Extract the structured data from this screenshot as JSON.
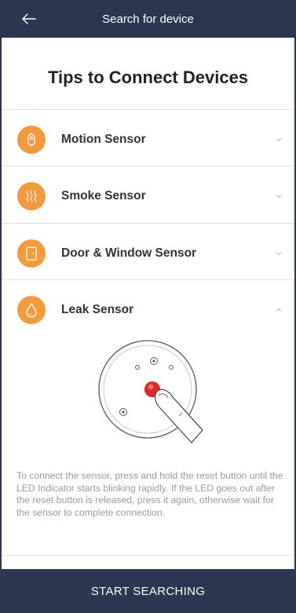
{
  "header": {
    "title": "Search for device",
    "back_icon": "arrow-left-icon"
  },
  "page": {
    "title": "Tips to Connect Devices"
  },
  "devices": [
    {
      "label": "Motion Sensor",
      "icon": "motion-sensor-icon",
      "expanded": false
    },
    {
      "label": "Smoke Sensor",
      "icon": "smoke-sensor-icon",
      "expanded": false
    },
    {
      "label": "Door & Window Sensor",
      "icon": "door-window-sensor-icon",
      "expanded": false
    },
    {
      "label": "Leak Sensor",
      "icon": "leak-sensor-icon",
      "expanded": true
    }
  ],
  "leak_sensor": {
    "instructions": "To connect the sensor, press and hold the reset button until the LED Indicator starts blinking rapidly. If the LED goes out after the reset button is released, press it again, otherwise wait for the sensor to complete connection."
  },
  "footer": {
    "button_label": "START SEARCHING"
  },
  "colors": {
    "header_bg": "#2b3652",
    "accent": "#f39a3c",
    "reset_button": "#d9292b"
  }
}
